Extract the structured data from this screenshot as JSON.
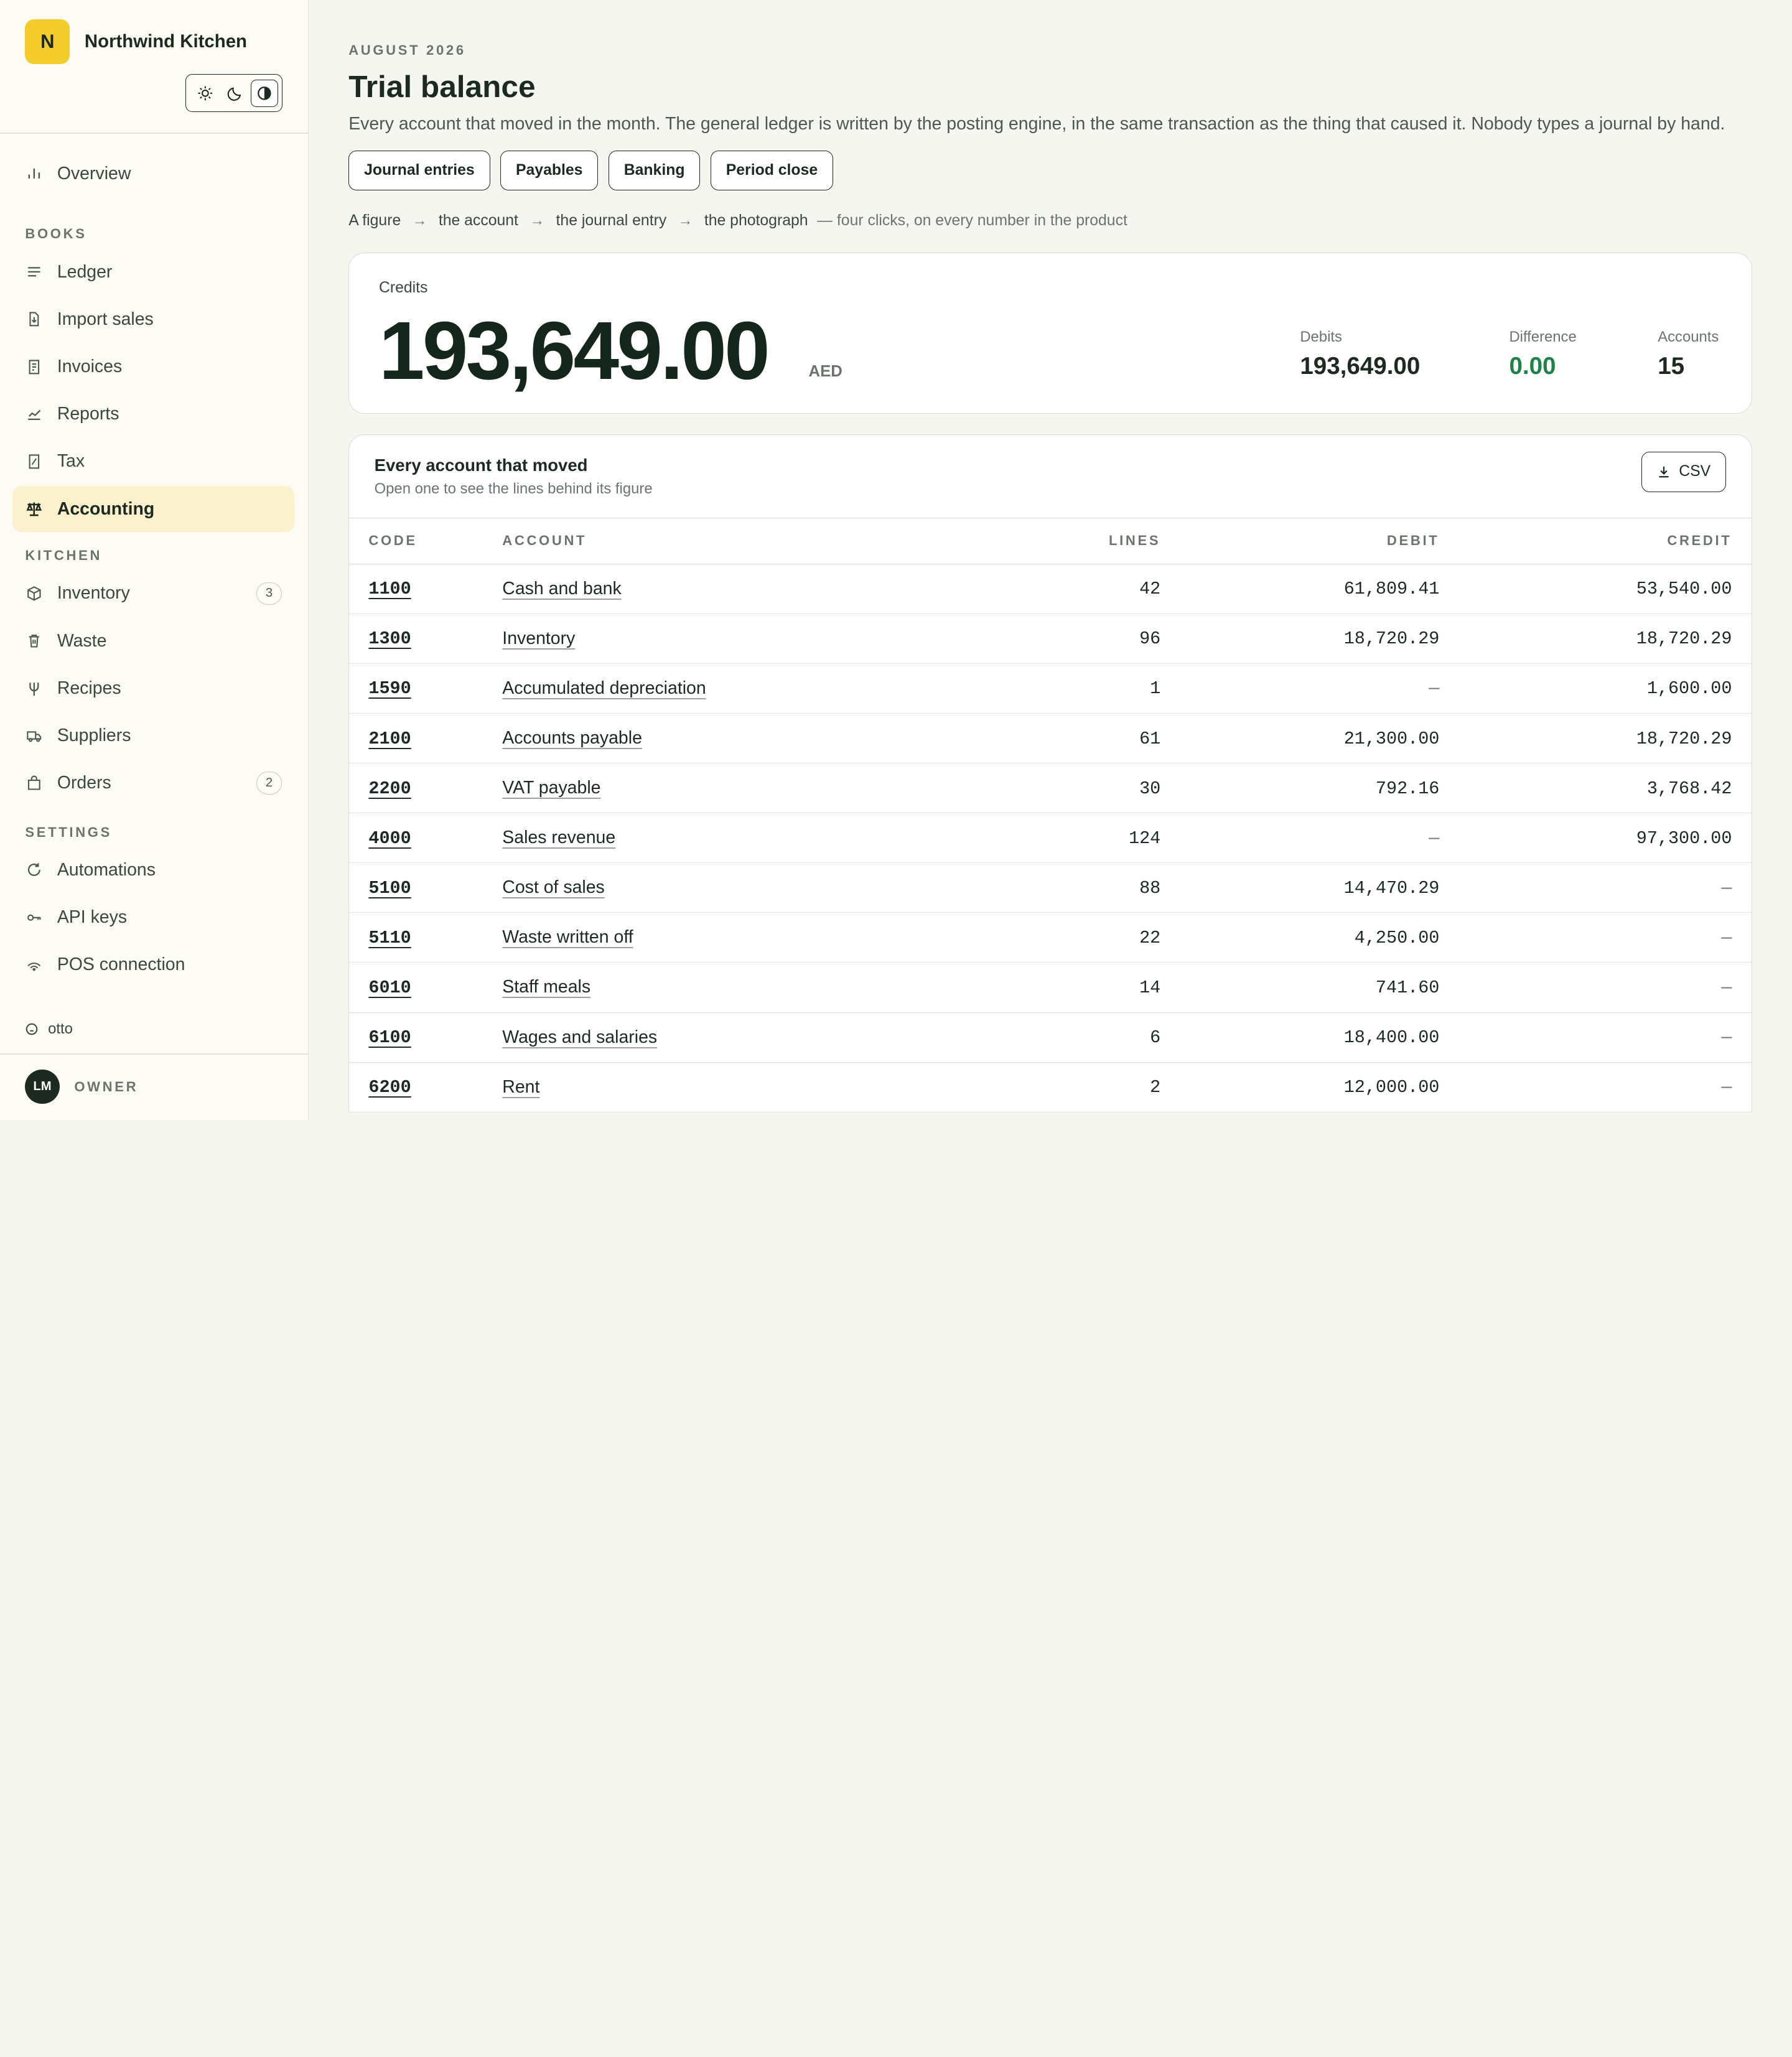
{
  "brand": {
    "initial": "N",
    "name": "Northwind Kitchen"
  },
  "nav": {
    "overview": "Overview",
    "books_label": "BOOKS",
    "books": [
      {
        "label": "Ledger",
        "icon": "lines-icon"
      },
      {
        "label": "Import sales",
        "icon": "file-import-icon"
      },
      {
        "label": "Invoices",
        "icon": "receipt-icon"
      },
      {
        "label": "Reports",
        "icon": "chart-line-icon"
      },
      {
        "label": "Tax",
        "icon": "tax-doc-icon"
      },
      {
        "label": "Accounting",
        "icon": "scale-icon",
        "active": true
      }
    ],
    "kitchen_label": "KITCHEN",
    "kitchen": [
      {
        "label": "Inventory",
        "icon": "box-icon",
        "badge": "3"
      },
      {
        "label": "Waste",
        "icon": "trash-icon"
      },
      {
        "label": "Recipes",
        "icon": "fork-icon"
      },
      {
        "label": "Suppliers",
        "icon": "truck-icon"
      },
      {
        "label": "Orders",
        "icon": "bag-icon",
        "badge": "2"
      }
    ],
    "settings_label": "SETTINGS",
    "settings": [
      {
        "label": "Automations",
        "icon": "refresh-icon"
      },
      {
        "label": "API keys",
        "icon": "key-icon"
      },
      {
        "label": "POS connection",
        "icon": "signal-icon"
      }
    ]
  },
  "footer": {
    "otto": "otto",
    "avatar": "LM",
    "role": "OWNER"
  },
  "header": {
    "period": "AUGUST 2026",
    "title": "Trial balance",
    "description": "Every account that moved in the month. The general ledger is written by the posting engine, in the same transaction as the thing that caused it. Nobody types a journal by hand."
  },
  "tabs": [
    "Journal entries",
    "Payables",
    "Banking",
    "Period close"
  ],
  "trail": {
    "steps": [
      "A figure",
      "the account",
      "the journal entry",
      "the photograph"
    ],
    "note": "— four clicks, on every number in the product"
  },
  "summary": {
    "credits_label": "Credits",
    "credits_value": "193,649.00",
    "currency": "AED",
    "debits_label": "Debits",
    "debits_value": "193,649.00",
    "difference_label": "Difference",
    "difference_value": "0.00",
    "accounts_label": "Accounts",
    "accounts_value": "15"
  },
  "table": {
    "title": "Every account that moved",
    "subtitle": "Open one to see the lines behind its figure",
    "csv_label": "CSV",
    "columns": [
      "CODE",
      "ACCOUNT",
      "LINES",
      "DEBIT",
      "CREDIT"
    ],
    "rows": [
      {
        "code": "1100",
        "account": "Cash and bank",
        "lines": "42",
        "debit": "61,809.41",
        "credit": "53,540.00"
      },
      {
        "code": "1300",
        "account": "Inventory",
        "lines": "96",
        "debit": "18,720.29",
        "credit": "18,720.29"
      },
      {
        "code": "1590",
        "account": "Accumulated depreciation",
        "lines": "1",
        "debit": "—",
        "credit": "1,600.00"
      },
      {
        "code": "2100",
        "account": "Accounts payable",
        "lines": "61",
        "debit": "21,300.00",
        "credit": "18,720.29"
      },
      {
        "code": "2200",
        "account": "VAT payable",
        "lines": "30",
        "debit": "792.16",
        "credit": "3,768.42"
      },
      {
        "code": "4000",
        "account": "Sales revenue",
        "lines": "124",
        "debit": "—",
        "credit": "97,300.00"
      },
      {
        "code": "5100",
        "account": "Cost of sales",
        "lines": "88",
        "debit": "14,470.29",
        "credit": "—"
      },
      {
        "code": "5110",
        "account": "Waste written off",
        "lines": "22",
        "debit": "4,250.00",
        "credit": "—"
      },
      {
        "code": "6010",
        "account": "Staff meals",
        "lines": "14",
        "debit": "741.60",
        "credit": "—"
      },
      {
        "code": "6100",
        "account": "Wages and salaries",
        "lines": "6",
        "debit": "18,400.00",
        "credit": "—"
      },
      {
        "code": "6200",
        "account": "Rent",
        "lines": "2",
        "debit": "12,000.00",
        "credit": "—"
      }
    ]
  },
  "colors": {
    "accent": "#f4cc2c",
    "active_bg": "#fcf1cd",
    "success": "#1f8249",
    "ink": "#1c2a22"
  }
}
